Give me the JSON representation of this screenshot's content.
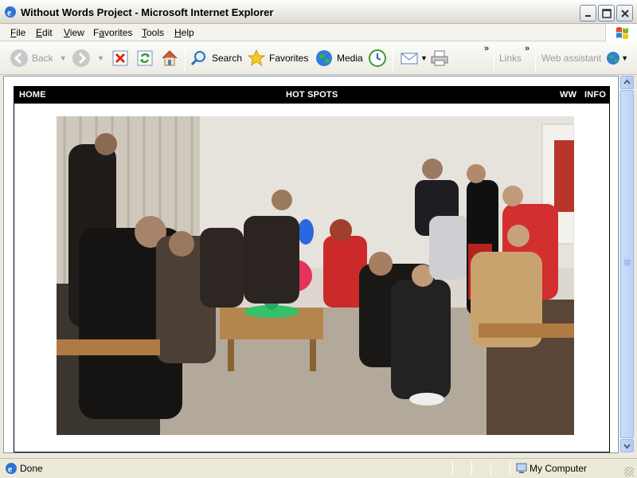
{
  "window": {
    "title": "Without Words Project - Microsoft Internet Explorer"
  },
  "menu": [
    "File",
    "Edit",
    "View",
    "Favorites",
    "Tools",
    "Help"
  ],
  "menu_access_keys": [
    "F",
    "E",
    "V",
    "a",
    "T",
    "H"
  ],
  "toolbar": {
    "back": "Back",
    "search": "Search",
    "favorites": "Favorites",
    "media": "Media",
    "links": "Links",
    "web_assistant": "Web assistant"
  },
  "site": {
    "nav": {
      "home": "HOME",
      "hot_spots": "HOT SPOTS",
      "ww": "WW",
      "info": "INFO"
    }
  },
  "status": {
    "text": "Done",
    "zone": "My Computer"
  },
  "colors": {
    "nav_bg": "#000000",
    "nav_text": "#ffffff",
    "scrollbar": "#bcd0f8"
  },
  "icons": [
    "ie-icon",
    "minimize-icon",
    "maximize-icon",
    "close-icon",
    "windows-flag-icon",
    "back-arrow-icon",
    "forward-arrow-icon",
    "stop-icon",
    "refresh-icon",
    "home-icon",
    "search-magnifier-icon",
    "favorites-star-icon",
    "media-globe-icon",
    "history-icon",
    "mail-icon",
    "print-icon",
    "web-assistant-globe-icon",
    "computer-zone-icon"
  ]
}
